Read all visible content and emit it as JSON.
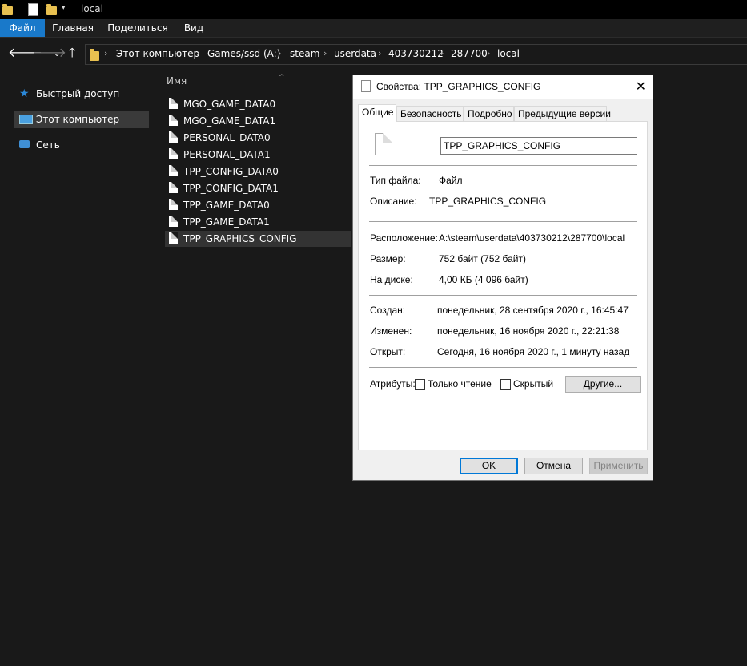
{
  "window": {
    "title": "local"
  },
  "ribbon": {
    "tabs": [
      "Файл",
      "Главная",
      "Поделиться",
      "Вид"
    ]
  },
  "address": {
    "crumbs": [
      "Этот компьютер",
      "Games/ssd (A:)",
      "steam",
      "userdata",
      "403730212",
      "287700",
      "local"
    ]
  },
  "nav": {
    "items": [
      "Быстрый доступ",
      "Этот компьютер",
      "Сеть"
    ]
  },
  "filelist": {
    "column_name": "Имя",
    "files": [
      "MGO_GAME_DATA0",
      "MGO_GAME_DATA1",
      "PERSONAL_DATA0",
      "PERSONAL_DATA1",
      "TPP_CONFIG_DATA0",
      "TPP_CONFIG_DATA1",
      "TPP_GAME_DATA0",
      "TPP_GAME_DATA1",
      "TPP_GRAPHICS_CONFIG"
    ]
  },
  "dialog": {
    "title": "Свойства: TPP_GRAPHICS_CONFIG",
    "tabs": [
      "Общие",
      "Безопасность",
      "Подробно",
      "Предыдущие версии"
    ],
    "file_name": "TPP_GRAPHICS_CONFIG",
    "type_label": "Тип файла:",
    "type_value": "Файл",
    "desc_label": "Описание:",
    "desc_value": "TPP_GRAPHICS_CONFIG",
    "loc_label": "Расположение:",
    "loc_value": "A:\\steam\\userdata\\403730212\\287700\\local",
    "size_label": "Размер:",
    "size_value": "752 байт (752 байт)",
    "disk_label": "На диске:",
    "disk_value": "4,00 КБ (4 096 байт)",
    "created_label": "Создан:",
    "created_value": "понедельник, 28 сентября 2020 г., 16:45:47",
    "modified_label": "Изменен:",
    "modified_value": "понедельник, 16 ноября 2020 г., 22:21:38",
    "opened_label": "Открыт:",
    "opened_value": "Сегодня, 16 ноября 2020 г., 1 минуту назад",
    "attr_label": "Атрибуты:",
    "readonly_label": "Только чтение",
    "hidden_label": "Скрытый",
    "other_button": "Другие...",
    "ok": "OK",
    "cancel": "Отмена",
    "apply": "Применить"
  },
  "colors": {
    "file_tab": "#1979ca",
    "background": "#191919",
    "selection": "#333333"
  }
}
